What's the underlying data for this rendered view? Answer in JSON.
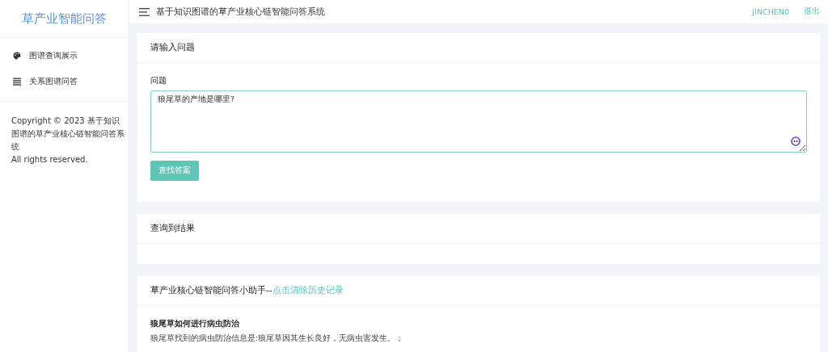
{
  "sidebar": {
    "title": "草产业智能问答",
    "items": [
      {
        "label": "图谱查询展示"
      },
      {
        "label": "关系图谱问答"
      }
    ],
    "copyright": [
      "Copyright © 2023 基于知识图谱的草产业核心链智能问答系统",
      "All rights reserved."
    ]
  },
  "header": {
    "title": "基于知识图谱的草产业核心链智能问答系统",
    "user": "JINCHEN0",
    "logout": "退出"
  },
  "question_card": {
    "title": "请输入问题",
    "field_label": "问题",
    "value": "狼尾草的产地是哪里?",
    "button": "查找答案"
  },
  "result_card": {
    "title": "查询到结果"
  },
  "history_card": {
    "title": "草产业核心链智能问答小助手--",
    "link": "点击清除历史记录",
    "entries": [
      {
        "question": "狼尾草如何进行病虫防治",
        "answer": "狼尾草找到的病虫防治信息是:狼尾草因其生长良好，无病虫害发生。；"
      }
    ]
  }
}
